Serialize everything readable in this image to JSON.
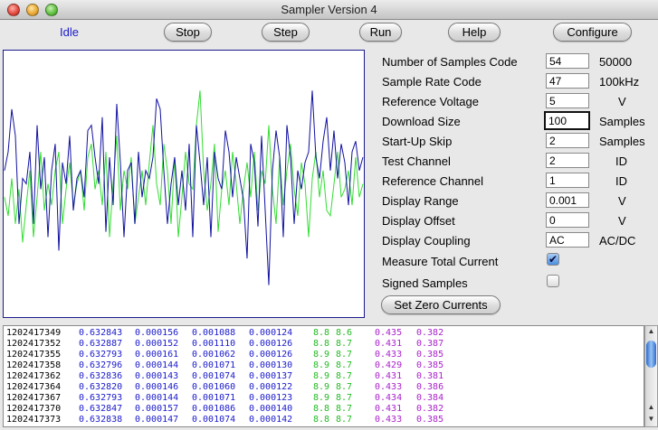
{
  "window": {
    "title": "Sampler Version 4"
  },
  "status": "Idle",
  "toolbar": [
    {
      "label": "Stop"
    },
    {
      "label": "Step"
    },
    {
      "label": "Run"
    },
    {
      "label": "Help"
    },
    {
      "label": "Configure"
    }
  ],
  "params": [
    {
      "label": "Number of Samples Code",
      "value": "54",
      "unit": "50000"
    },
    {
      "label": "Sample Rate Code",
      "value": "47",
      "unit": "100kHz"
    },
    {
      "label": "Reference Voltage",
      "value": "5",
      "unit": "V"
    },
    {
      "label": "Download Size",
      "value": "100",
      "unit": "Samples"
    },
    {
      "label": "Start-Up Skip",
      "value": "2",
      "unit": "Samples"
    },
    {
      "label": "Test Channel",
      "value": "2",
      "unit": "ID"
    },
    {
      "label": "Reference Channel",
      "value": "1",
      "unit": "ID"
    },
    {
      "label": "Display Range",
      "value": "0.001",
      "unit": "V"
    },
    {
      "label": "Display Offset",
      "value": "0",
      "unit": "V"
    },
    {
      "label": "Display Coupling",
      "value": "AC",
      "unit": "AC/DC"
    }
  ],
  "checks": [
    {
      "label": "Measure Total Current",
      "checked": true
    },
    {
      "label": "Signed Samples",
      "checked": false
    }
  ],
  "zero_button": "Set Zero Currents",
  "colors": {
    "blue_trace": "#1010a0",
    "green_trace": "#33dd33",
    "log_blue": "#1a1acc",
    "log_green": "#22bb22",
    "log_magenta": "#aa22cc"
  },
  "waveform": {
    "blue": [
      0.55,
      0.62,
      0.78,
      0.68,
      0.35,
      0.52,
      0.5,
      0.62,
      0.35,
      0.72,
      0.48,
      0.6,
      0.3,
      0.55,
      0.65,
      0.25,
      0.58,
      0.5,
      0.68,
      0.4,
      0.52,
      0.55,
      0.45,
      0.7,
      0.72,
      0.6,
      0.5,
      0.75,
      0.32,
      0.6,
      0.42,
      0.8,
      0.58,
      0.3,
      0.55,
      0.58,
      0.35,
      0.62,
      0.45,
      0.55,
      0.52,
      0.6,
      0.82,
      0.78,
      0.55,
      0.35,
      0.5,
      0.6,
      0.42,
      0.55,
      0.4,
      0.65,
      0.3,
      0.72,
      0.58,
      0.42,
      0.6,
      0.3,
      0.62,
      0.52,
      0.48,
      0.7,
      0.62,
      0.45,
      0.6,
      0.52,
      0.44,
      0.22,
      0.65,
      0.58,
      0.34,
      0.68,
      0.4,
      0.12,
      0.55,
      0.7,
      0.6,
      0.3,
      0.72,
      0.6,
      0.35,
      0.55,
      0.48,
      0.58,
      0.62,
      0.85,
      0.6,
      0.52,
      0.66,
      0.75,
      0.55,
      0.7,
      0.52,
      0.65,
      0.58,
      0.42,
      0.62,
      0.66,
      0.55,
      0.6
    ],
    "green": [
      0.45,
      0.38,
      0.52,
      0.35,
      0.48,
      0.28,
      0.42,
      0.55,
      0.3,
      0.45,
      0.62,
      0.4,
      0.5,
      0.42,
      0.55,
      0.62,
      0.35,
      0.48,
      0.58,
      0.42,
      0.5,
      0.55,
      0.4,
      0.6,
      0.65,
      0.48,
      0.55,
      0.42,
      0.62,
      0.3,
      0.5,
      0.68,
      0.4,
      0.55,
      0.48,
      0.6,
      0.35,
      0.45,
      0.55,
      0.42,
      0.58,
      0.72,
      0.5,
      0.42,
      0.65,
      0.55,
      0.35,
      0.6,
      0.3,
      0.45,
      0.62,
      0.5,
      0.48,
      0.72,
      0.85,
      0.55,
      0.4,
      0.5,
      0.65,
      0.32,
      0.48,
      0.55,
      0.42,
      0.62,
      0.5,
      0.35,
      0.48,
      0.58,
      0.45,
      0.62,
      0.4,
      0.55,
      0.5,
      0.72,
      0.48,
      0.35,
      0.6,
      0.42,
      0.55,
      0.65,
      0.48,
      0.38,
      0.58,
      0.5,
      0.3,
      0.52,
      0.62,
      0.45,
      0.55,
      0.4,
      0.38,
      0.5,
      0.62,
      0.45,
      0.48,
      0.55,
      0.42,
      0.6,
      0.45,
      0.5
    ]
  },
  "log_rows": [
    [
      "1202417349",
      "0.632843",
      "0.000156",
      "0.001088",
      "0.000124",
      "8.8",
      "8.6",
      "0.435",
      "0.382"
    ],
    [
      "1202417352",
      "0.632887",
      "0.000152",
      "0.001110",
      "0.000126",
      "8.8",
      "8.7",
      "0.431",
      "0.387"
    ],
    [
      "1202417355",
      "0.632793",
      "0.000161",
      "0.001062",
      "0.000126",
      "8.9",
      "8.7",
      "0.433",
      "0.385"
    ],
    [
      "1202417358",
      "0.632796",
      "0.000144",
      "0.001071",
      "0.000130",
      "8.9",
      "8.7",
      "0.429",
      "0.385"
    ],
    [
      "1202417362",
      "0.632836",
      "0.000143",
      "0.001074",
      "0.000137",
      "8.9",
      "8.7",
      "0.431",
      "0.381"
    ],
    [
      "1202417364",
      "0.632820",
      "0.000146",
      "0.001060",
      "0.000122",
      "8.9",
      "8.7",
      "0.433",
      "0.386"
    ],
    [
      "1202417367",
      "0.632793",
      "0.000144",
      "0.001071",
      "0.000123",
      "8.9",
      "8.7",
      "0.434",
      "0.384"
    ],
    [
      "1202417370",
      "0.632847",
      "0.000157",
      "0.001086",
      "0.000140",
      "8.8",
      "8.7",
      "0.431",
      "0.382"
    ],
    [
      "1202417373",
      "0.632838",
      "0.000147",
      "0.001074",
      "0.000142",
      "8.8",
      "8.7",
      "0.433",
      "0.385"
    ]
  ]
}
